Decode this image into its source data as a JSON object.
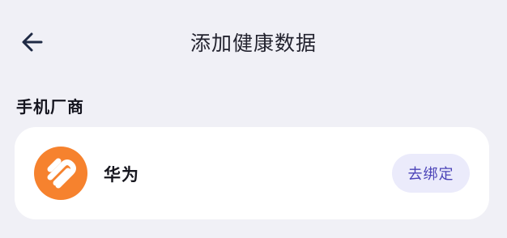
{
  "header": {
    "back_icon": "arrow-left-icon",
    "title": "添加健康数据"
  },
  "section": {
    "title": "手机厂商"
  },
  "vendors": [
    {
      "name": "华为",
      "icon": "huawei-health-logo",
      "action_label": "去绑定",
      "brand_color": "#f6822e",
      "action_bg": "#ebebfb",
      "action_text_color": "#4c44b8"
    }
  ],
  "colors": {
    "background": "#f0f0f6",
    "card": "#ffffff"
  }
}
